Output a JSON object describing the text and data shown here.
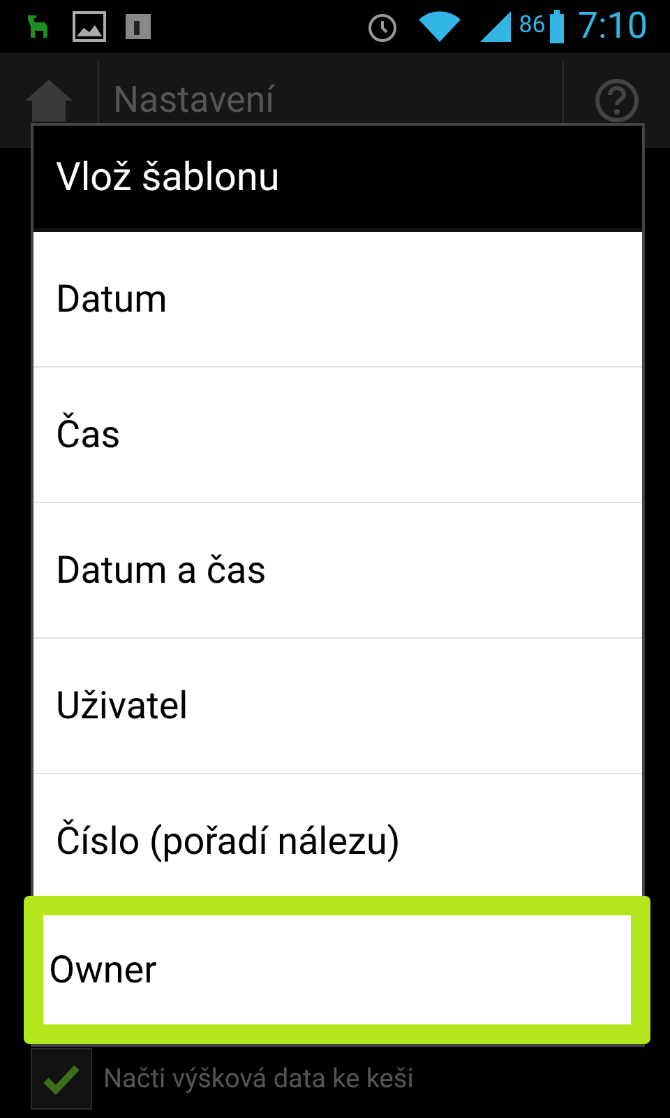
{
  "status_bar": {
    "battery": "86",
    "time": "7:10"
  },
  "action_bar": {
    "title": "Nastavení"
  },
  "background_setting": {
    "label": "Načti výšková data ke keši",
    "checked": true
  },
  "dialog": {
    "title": "Vlož šablonu",
    "items": [
      {
        "label": "Datum",
        "selected": false
      },
      {
        "label": "Čas",
        "selected": false
      },
      {
        "label": "Datum a čas",
        "selected": false
      },
      {
        "label": "Uživatel",
        "selected": false
      },
      {
        "label": "Číslo (pořadí nálezu)",
        "selected": false
      },
      {
        "label": "Owner",
        "selected": true
      }
    ]
  }
}
